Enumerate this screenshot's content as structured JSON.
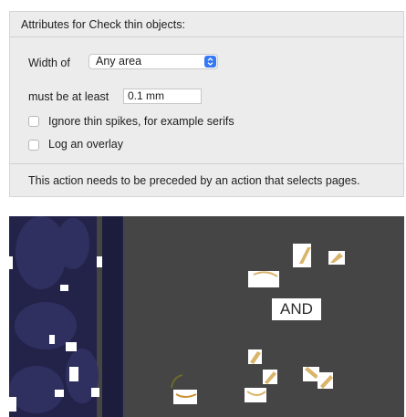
{
  "panel": {
    "title": "Attributes for Check thin objects:",
    "width_label": "Width of",
    "width_value": "Any area",
    "min_label": "must be at least",
    "min_value": "0.1 mm",
    "options": [
      {
        "label": "Ignore thin spikes, for example serifs",
        "checked": false
      },
      {
        "label": "Log an overlay",
        "checked": false
      }
    ],
    "info": "This action needs to be preceded by an action that selects pages."
  },
  "preview": {
    "label": "AND",
    "colors": {
      "background": "#454545",
      "navy": "#23234a",
      "highlight": "#ffffff",
      "tan": "#d9b46b"
    }
  }
}
